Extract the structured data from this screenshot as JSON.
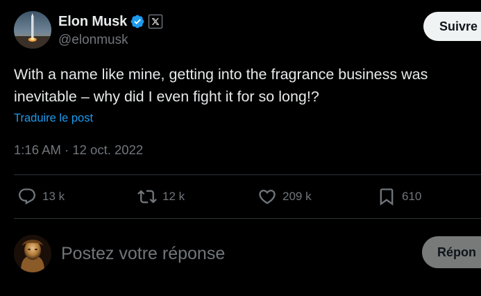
{
  "author": {
    "display_name": "Elon Musk",
    "handle": "@elonmusk",
    "verified_icon": "verified-badge-icon",
    "affiliation_icon": "x-logo-icon"
  },
  "follow_label": "Suivre",
  "tweet": {
    "text": "With a name like mine, getting into the fragrance business was inevitable – why did I even fight it for so long!?",
    "translate_label": "Traduire le post",
    "timestamp": "1:16 AM · 12 oct. 2022"
  },
  "actions": {
    "replies": "13 k",
    "reposts": "12 k",
    "likes": "209 k",
    "bookmarks": "610"
  },
  "reply_box": {
    "placeholder": "Postez votre réponse",
    "button_label": "Répon"
  },
  "colors": {
    "background": "#000000",
    "text": "#e7e9ea",
    "muted": "#71767b",
    "link": "#1d9bf0",
    "verified": "#1d9bf0"
  }
}
